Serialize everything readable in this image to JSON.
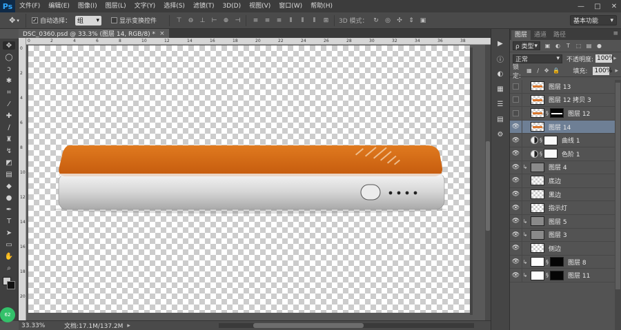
{
  "app": {
    "logo": "Ps"
  },
  "menu": [
    "文件(F)",
    "编辑(E)",
    "图像(I)",
    "图层(L)",
    "文字(Y)",
    "选择(S)",
    "滤镜(T)",
    "3D(D)",
    "视图(V)",
    "窗口(W)",
    "帮助(H)"
  ],
  "window_controls": {
    "minimize": "—",
    "maximize": "□",
    "close": "✕"
  },
  "options": {
    "auto_select_label": "自动选择：",
    "auto_select_value": "组",
    "show_transform_label": "显示变换控件",
    "mode_3d_label": "3D 模式：",
    "workspace": "基本功能"
  },
  "document": {
    "tab_title": "DSC_0360.psd @ 33.3% (图层 14, RGB/8) *",
    "close": "×"
  },
  "status": {
    "zoom": "33.33%",
    "doc_info": "文档:17.1M/137.2M",
    "arrow": "▸"
  },
  "canvas_badge": "62",
  "ruler_numbers": [
    "0",
    "2",
    "4",
    "6",
    "8",
    "10",
    "12",
    "14",
    "16",
    "18",
    "20",
    "22",
    "24",
    "26",
    "28",
    "30",
    "32",
    "34",
    "36",
    "38"
  ],
  "ruler_v_numbers": [
    "0",
    "2",
    "4",
    "6",
    "8",
    "10",
    "12",
    "14",
    "16",
    "18",
    "20"
  ],
  "panel": {
    "tabs": [
      "图层",
      "通道",
      "路径"
    ],
    "menu_icon": "≡",
    "filter_kind": "ρ 类型",
    "blend_mode": "正常",
    "opacity_label": "不透明度:",
    "opacity_value": "100%",
    "lock_label": "锁定:",
    "fill_label": "填充:",
    "fill_value": "100%"
  },
  "layers": [
    {
      "name": "图层 13",
      "visible": false,
      "thumb": "line"
    },
    {
      "name": "图层 12 拷贝 3",
      "visible": false,
      "thumb": "line"
    },
    {
      "name": "图层 12",
      "visible": false,
      "thumb": "line",
      "mask": "black"
    },
    {
      "name": "图层 14",
      "visible": true,
      "thumb": "line",
      "selected": true
    },
    {
      "name": "曲线 1",
      "visible": true,
      "thumb": "adj",
      "mask": "white"
    },
    {
      "name": "色阶 1",
      "visible": true,
      "thumb": "adj",
      "mask": "white"
    },
    {
      "name": "图层 4",
      "visible": true,
      "thumb": "gray",
      "clip": true
    },
    {
      "name": "底边",
      "visible": true,
      "thumb": "checker"
    },
    {
      "name": "黑边",
      "visible": true,
      "thumb": "checker"
    },
    {
      "name": "指示灯",
      "visible": true,
      "thumb": "checker"
    },
    {
      "name": "图层 5",
      "visible": true,
      "thumb": "gray",
      "clip": true
    },
    {
      "name": "图层 3",
      "visible": true,
      "thumb": "gray",
      "clip": true
    },
    {
      "name": "侧边",
      "visible": true,
      "thumb": "checker"
    },
    {
      "name": "图层 8",
      "visible": true,
      "thumb": "white",
      "mask": "black",
      "clip": true
    },
    {
      "name": "图层 11",
      "visible": true,
      "thumb": "white",
      "mask": "black",
      "clip": true
    }
  ],
  "colors": {
    "accent_orange": "#d9772d",
    "selected_layer": "#6e7f95",
    "logo_blue": "#31a8ff"
  }
}
